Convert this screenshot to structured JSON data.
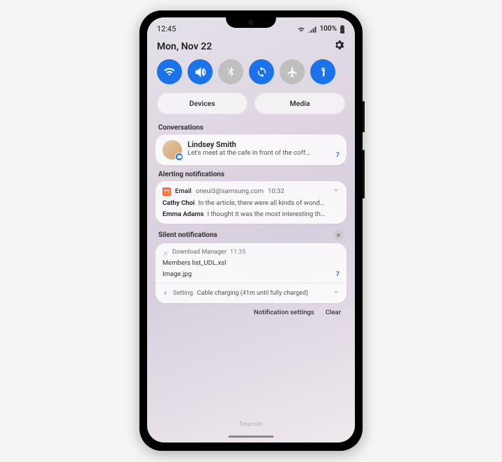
{
  "status": {
    "time": "12:45",
    "battery_text": "100%"
  },
  "header": {
    "date": "Mon, Nov 22"
  },
  "toggles": {
    "wifi": true,
    "sound": true,
    "bluetooth": false,
    "sync": true,
    "airplane": false,
    "flashlight": true
  },
  "pills": {
    "devices": "Devices",
    "media": "Media"
  },
  "sections": {
    "conversations": "Conversations",
    "alerting": "Alerting notifications",
    "silent": "Silent notifications"
  },
  "conversation": {
    "name": "Lindsey Smith",
    "message": "Let's meet at the cafe in front of the coff…",
    "count": "7"
  },
  "email": {
    "app": "Email",
    "account": "oneui3@samsung.com",
    "time": "10:32",
    "items": [
      {
        "sender": "Cathy Choi",
        "body": "In the article, there were all kinds of wond…"
      },
      {
        "sender": "Emma Adams",
        "body": "I thought it was the most interesting th…"
      }
    ]
  },
  "download": {
    "app": "Download Manager",
    "time": "11:35",
    "files": [
      {
        "name": "Members list_UDL.xsl",
        "count": ""
      },
      {
        "name": "Image.jpg",
        "count": "7"
      }
    ]
  },
  "charging": {
    "app": "Setting",
    "text": "Cable charging (41m until fully charged)"
  },
  "footer": {
    "settings": "Notification settings",
    "clear": "Clear"
  },
  "carrier": "Telecom"
}
